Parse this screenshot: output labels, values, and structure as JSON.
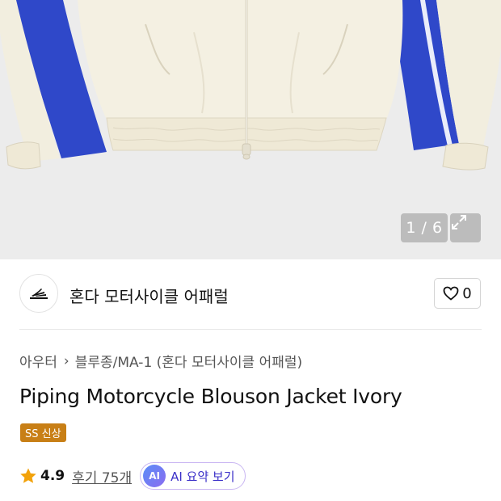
{
  "gallery": {
    "counter": "1 / 6",
    "expand_icon": "expand-icon",
    "colors": {
      "ivory": "#f3efe1",
      "blue": "#2f48c9",
      "background": "#ececec"
    }
  },
  "brand": {
    "logo_icon": "honda-wing-logo",
    "name": "혼다 모터사이클 어패럴",
    "like_icon": "heart-outline-icon",
    "like_count": "0"
  },
  "breadcrumb": {
    "level1": "아우터",
    "separator_icon": "chevron-right-icon",
    "level2": "블루종/MA-1 (혼다 모터사이클 어패럴)"
  },
  "product": {
    "title": "Piping Motorcycle Blouson Jacket Ivory",
    "badge": "SS 신상",
    "badge_color": "#c87f16"
  },
  "rating": {
    "star_icon": "star-icon",
    "star_color": "#f2a20b",
    "score": "4.9",
    "reviews_label": "후기 75개",
    "ai_chip": "AI",
    "ai_label": "AI 요약 보기"
  }
}
